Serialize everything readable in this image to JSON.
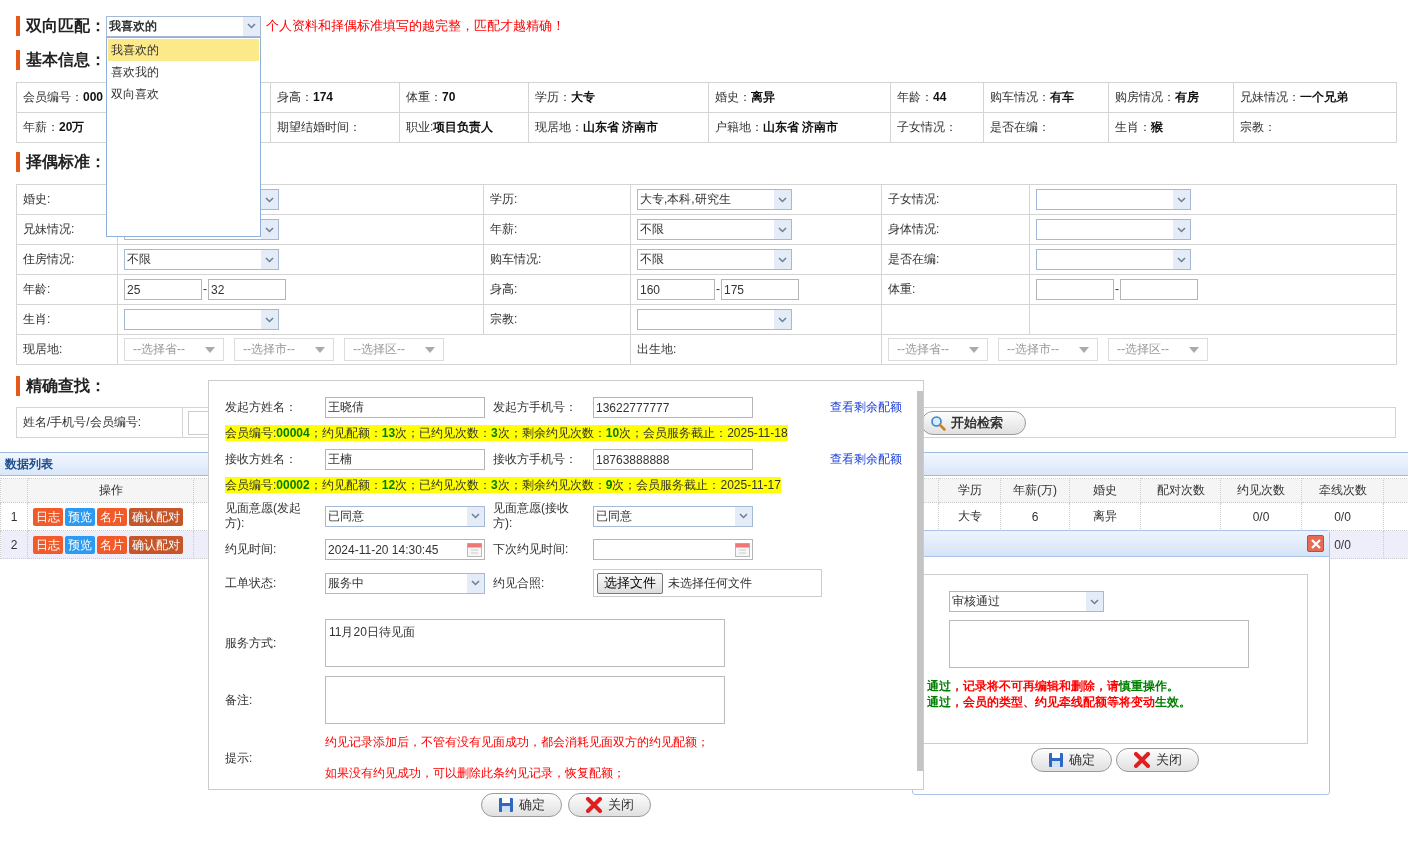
{
  "match": {
    "title": "双向匹配：",
    "value": "我喜欢的",
    "hint": "个人资料和择偶标准填写的越完整，匹配才越精确！",
    "expanded": true,
    "options": [
      {
        "label": "我喜欢的",
        "selected": true
      },
      {
        "label": "喜欢我的",
        "selected": false
      },
      {
        "label": "双向喜欢",
        "selected": false
      }
    ]
  },
  "basic_info": {
    "title": "基本信息：",
    "rows": [
      [
        {
          "label": "会员编号：",
          "value": "000"
        },
        {
          "label": "身高：",
          "value": "174"
        },
        {
          "label": "体重：",
          "value": "70"
        },
        {
          "label": "学历：",
          "value": "大专"
        },
        {
          "label": "婚史：",
          "value": "离异"
        },
        {
          "label": "年龄：",
          "value": "44"
        },
        {
          "label": "购车情况：",
          "value": "有车"
        },
        {
          "label": "购房情况：",
          "value": "有房"
        },
        {
          "label": "兄妹情况：",
          "value": "一个兄弟"
        }
      ],
      [
        {
          "label": "年薪：",
          "value": "20万"
        },
        {
          "label": "期望结婚时间："
        },
        {
          "label": "职业:",
          "value": "项目负责人"
        },
        {
          "label": "现居地：",
          "value": "山东省 济南市"
        },
        {
          "label": "户籍地：",
          "value": "山东省 济南市"
        },
        {
          "label": "子女情况："
        },
        {
          "label": "是否在编："
        },
        {
          "label": "生肖：",
          "value": "猴"
        },
        {
          "label": "宗教："
        }
      ]
    ]
  },
  "criteria": {
    "title": "择偶标准：",
    "rows": [
      [
        {
          "kind": "label",
          "text": "婚史:"
        },
        {
          "kind": "select"
        },
        {
          "kind": "label",
          "text": "学历:"
        },
        {
          "kind": "select",
          "value": "大专,本科,研究生"
        },
        {
          "kind": "label",
          "text": "子女情况:"
        },
        {
          "kind": "select"
        }
      ],
      [
        {
          "kind": "label",
          "text": "兄妹情况:"
        },
        {
          "kind": "select"
        },
        {
          "kind": "label",
          "text": "年薪:"
        },
        {
          "kind": "select",
          "value": "不限"
        },
        {
          "kind": "label",
          "text": "身体情况:"
        },
        {
          "kind": "select"
        }
      ],
      [
        {
          "kind": "label",
          "text": "住房情况:"
        },
        {
          "kind": "select",
          "value": "不限"
        },
        {
          "kind": "label",
          "text": "购车情况:"
        },
        {
          "kind": "select",
          "value": "不限"
        },
        {
          "kind": "label",
          "text": "是否在编:"
        },
        {
          "kind": "select"
        }
      ],
      [
        {
          "kind": "label",
          "text": "年龄:"
        },
        {
          "kind": "range",
          "from": "25",
          "separator": "-",
          "to": "32"
        },
        {
          "kind": "label",
          "text": "身高:"
        },
        {
          "kind": "range",
          "from": "160",
          "separator": "-",
          "to": "175"
        },
        {
          "kind": "label",
          "text": "体重:"
        },
        {
          "kind": "range",
          "separator": "-"
        }
      ],
      [
        {
          "kind": "label",
          "text": "生肖:"
        },
        {
          "kind": "select"
        },
        {
          "kind": "label",
          "text": "宗教:"
        },
        {
          "kind": "select"
        }
      ],
      [
        {
          "kind": "label",
          "text": "现居地:"
        },
        {
          "kind": "region",
          "colspan": 2,
          "options": [
            "--选择省--",
            "--选择市--",
            "--选择区--"
          ]
        },
        {
          "kind": "label",
          "text": "出生地:"
        },
        {
          "kind": "region",
          "colspan": 2,
          "options": [
            "--选择省--",
            "--选择市--",
            "--选择区--"
          ]
        }
      ]
    ]
  },
  "search": {
    "title": "精确查找：",
    "label": "姓名/手机号/会员编号:",
    "button": "开始检索"
  },
  "list": {
    "title": "数据列表",
    "action_header": "操作",
    "columns": [
      "学历",
      "年薪(万)",
      "婚史",
      "配对次数",
      "约见次数",
      "牵线次数"
    ],
    "rows": [
      {
        "index": "1",
        "selected": false,
        "actions": [
          {
            "label": "日志",
            "color": "#f25a29"
          },
          {
            "label": "预览",
            "color": "#2b9af3"
          },
          {
            "label": "名片",
            "color": "#f25a29"
          },
          {
            "label": "确认配对",
            "color": "#c4562a"
          }
        ],
        "cells": [
          "大专",
          "6",
          "离异",
          null,
          "0/0",
          "0/0"
        ]
      },
      {
        "index": "2",
        "selected": true,
        "actions": [
          {
            "label": "日志",
            "color": "#f25a29"
          },
          {
            "label": "预览",
            "color": "#2b9af3"
          },
          {
            "label": "名片",
            "color": "#f25a29"
          },
          {
            "label": "确认配对",
            "color": "#c4562a"
          }
        ],
        "cells": [
          null,
          null,
          null,
          null,
          null,
          "0/0"
        ]
      }
    ]
  },
  "appointment": {
    "parties": [
      {
        "name_label": "发起方姓名：",
        "name": "王晓倩",
        "phone_label": "发起方手机号：",
        "phone": "13622777777",
        "link": "查看剩余配额",
        "quota": "会员编号:**00004**；约见配额：**13**次；已约见次数：**3**次；剩余约见次数：**10**次；会员服务截止：2025-11-18"
      },
      {
        "name_label": "接收方姓名：",
        "name": "王楠",
        "phone_label": "接收方手机号：",
        "phone": "18763888888",
        "link": "查看剩余配额",
        "quota": "会员编号:**00002**；约见配额：**12**次；已约见次数：**3**次；剩余约见次数：**9**次；会员服务截止：2025-11-17"
      }
    ],
    "willingness": [
      {
        "label": "见面意愿(发起方):",
        "value": "已同意"
      },
      {
        "label": "见面意愿(接收方):",
        "value": "已同意"
      }
    ],
    "time": {
      "label": "约见时间:",
      "value": "2024-11-20 14:30:45"
    },
    "next_time": {
      "label": "下次约见时间:"
    },
    "status": {
      "label": "工单状态:",
      "value": "服务中"
    },
    "photo": {
      "label": "约见合照:",
      "button": "选择文件",
      "file": "未选择任何文件"
    },
    "service": {
      "label": "服务方式:",
      "value": "11月20日待见面"
    },
    "remark": {
      "label": "备注:"
    },
    "tips": {
      "label": "提示:",
      "lines": [
        "约见记录添加后，不管有没有见面成功，都会消耗见面双方的约见配额；",
        "如果没有约见成功，可以删除此条约见记录，恢复配额；"
      ]
    },
    "buttons": [
      {
        "kind": "ok",
        "label": "确定"
      },
      {
        "kind": "close",
        "label": "关闭"
      }
    ]
  },
  "review": {
    "value": "审核通过",
    "notes": [
      [
        {
          "text": "通过",
          "color": "#008000"
        },
        {
          "text": "，记录将不可再编辑和删除，请",
          "color": "#ff0000"
        },
        {
          "text": "慎重操作。",
          "color": "#008000"
        }
      ],
      [
        {
          "text": "通过",
          "color": "#008000"
        },
        {
          "text": "，会员的类型、约见牵线配额等将变动",
          "color": "#ff0000"
        },
        {
          "text": "生效。",
          "color": "#008000"
        }
      ]
    ],
    "buttons": [
      {
        "kind": "ok",
        "label": "确定"
      },
      {
        "kind": "close",
        "label": "关闭"
      }
    ]
  }
}
